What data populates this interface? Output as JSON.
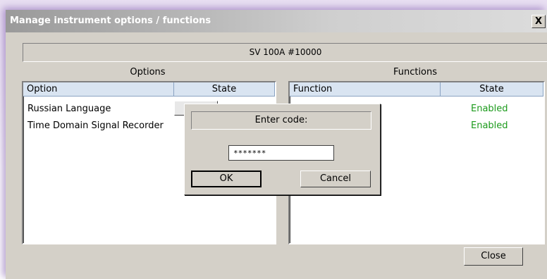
{
  "window": {
    "title": "Manage instrument options / functions",
    "close_glyph": "X"
  },
  "device": {
    "name": "SV 100A #10000"
  },
  "options": {
    "section_label": "Options",
    "columns": [
      "Option",
      "State"
    ],
    "rows": [
      {
        "option": "Russian Language",
        "state": ""
      },
      {
        "option": "Time Domain Signal Recorder",
        "state": ""
      }
    ]
  },
  "functions": {
    "section_label": "Functions",
    "columns": [
      "Function",
      "State"
    ],
    "rows": [
      {
        "function": "",
        "state": "Enabled"
      },
      {
        "function": "",
        "state": "Enabled"
      }
    ]
  },
  "code_dialog": {
    "label": "Enter code:",
    "value": "*******",
    "ok_label": "OK",
    "cancel_label": "Cancel"
  },
  "footer": {
    "close_label": "Close"
  },
  "colors": {
    "enabled": "#1a9a1a",
    "header": "#d9e4f1",
    "face": "#d4d0c8"
  }
}
